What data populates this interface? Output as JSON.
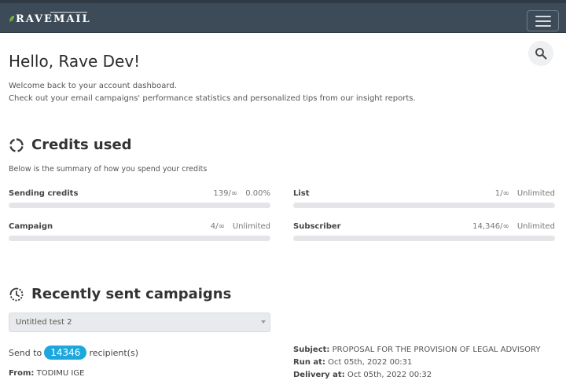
{
  "brand": {
    "logo_text": "RAVEMAIL"
  },
  "header": {
    "greeting": "Hello, Rave Dev!"
  },
  "intro": {
    "line1": "Welcome back to your account dashboard.",
    "line2": "Check out your email campaigns' performance statistics and personalized tips from our insight reports."
  },
  "credits": {
    "title": "Credits used",
    "summary": "Below is the summary of how you spend your credits",
    "items": [
      {
        "label": "Sending credits",
        "used": "139/∞",
        "pct": "0.00%",
        "fill_fraction": 0
      },
      {
        "label": "List",
        "used": "1/∞",
        "pct": "Unlimited",
        "fill_fraction": 0
      },
      {
        "label": "Campaign",
        "used": "4/∞",
        "pct": "Unlimited",
        "fill_fraction": 0
      },
      {
        "label": "Subscriber",
        "used": "14,346/∞",
        "pct": "Unlimited",
        "fill_fraction": 0
      }
    ]
  },
  "campaigns": {
    "title": "Recently sent campaigns",
    "selected": "Untitled test 2",
    "send_to_prefix": "Send to",
    "recipients": "14346",
    "send_to_suffix": "recipient(s)",
    "from_label": "From:",
    "from_value": "TODIMU IGE",
    "subject_label": "Subject:",
    "subject_value": "PROPOSAL FOR THE PROVISION OF LEGAL ADVISORY",
    "run_label": "Run at:",
    "run_value": "Oct 05th, 2022 00:31",
    "delivery_label": "Delivery at:",
    "delivery_value": "Oct 05th, 2022 00:32"
  },
  "colors": {
    "navbar": "#3c4b57",
    "accent": "#1ca7dd"
  },
  "icons": {
    "search": "search-icon",
    "menu": "hamburger-icon",
    "credits": "circle-notch-icon",
    "recent": "history-icon"
  }
}
